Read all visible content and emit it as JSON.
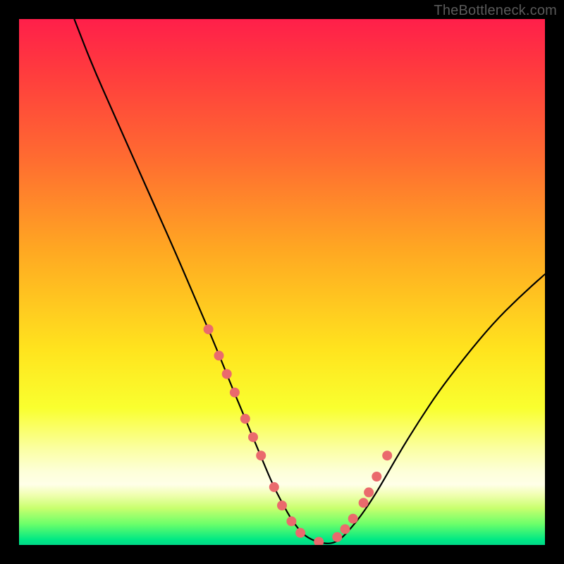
{
  "watermark": "TheBottleneck.com",
  "chart_data": {
    "type": "line",
    "title": "",
    "xlabel": "",
    "ylabel": "",
    "xlim": [
      0,
      100
    ],
    "ylim": [
      0,
      100
    ],
    "grid": false,
    "legend": false,
    "background_gradient": {
      "orientation": "vertical",
      "stops": [
        {
          "pos": 0.0,
          "color": "#ff1f4a"
        },
        {
          "pos": 0.1,
          "color": "#ff3b3e"
        },
        {
          "pos": 0.26,
          "color": "#ff6a31"
        },
        {
          "pos": 0.44,
          "color": "#ffa822"
        },
        {
          "pos": 0.63,
          "color": "#ffe41e"
        },
        {
          "pos": 0.74,
          "color": "#f9ff2f"
        },
        {
          "pos": 0.82,
          "color": "#fbffa6"
        },
        {
          "pos": 0.86,
          "color": "#fdffd8"
        },
        {
          "pos": 0.885,
          "color": "#ffffe8"
        },
        {
          "pos": 0.905,
          "color": "#f0ffb0"
        },
        {
          "pos": 0.93,
          "color": "#c8ff6e"
        },
        {
          "pos": 0.96,
          "color": "#6cff6a"
        },
        {
          "pos": 0.99,
          "color": "#00e884"
        },
        {
          "pos": 1.0,
          "color": "#00d988"
        }
      ]
    },
    "series": [
      {
        "name": "bottleneck-curve",
        "color": "#000000",
        "x": [
          10.5,
          14,
          18,
          22,
          26,
          30,
          33,
          36,
          38.5,
          40.5,
          43,
          45.5,
          48,
          50,
          52,
          54,
          56,
          58,
          59.5,
          61,
          62.5,
          65,
          68,
          72,
          76,
          80,
          85,
          90,
          95,
          100
        ],
        "y": [
          100,
          91,
          82,
          73,
          64,
          55,
          48,
          41,
          35,
          30,
          24,
          18,
          12,
          8,
          4.5,
          2,
          0.8,
          0.3,
          0.3,
          1,
          2.5,
          5.5,
          10,
          17,
          23.5,
          29.5,
          36,
          42,
          47,
          51.5
        ]
      },
      {
        "name": "highlight-dots",
        "color": "#ea6a6d",
        "type": "scatter",
        "x": [
          36,
          38,
          39.5,
          41,
          43,
          44.5,
          46,
          48.5,
          50,
          51.8,
          53.5,
          57,
          60.5,
          62,
          63.5,
          65.5,
          66.5,
          68,
          70
        ],
        "y": [
          41,
          36,
          32.5,
          29,
          24,
          20.5,
          17,
          11,
          7.5,
          4.5,
          2.3,
          0.6,
          1.5,
          3,
          5,
          8,
          10,
          13,
          17
        ]
      }
    ],
    "annotations": []
  }
}
